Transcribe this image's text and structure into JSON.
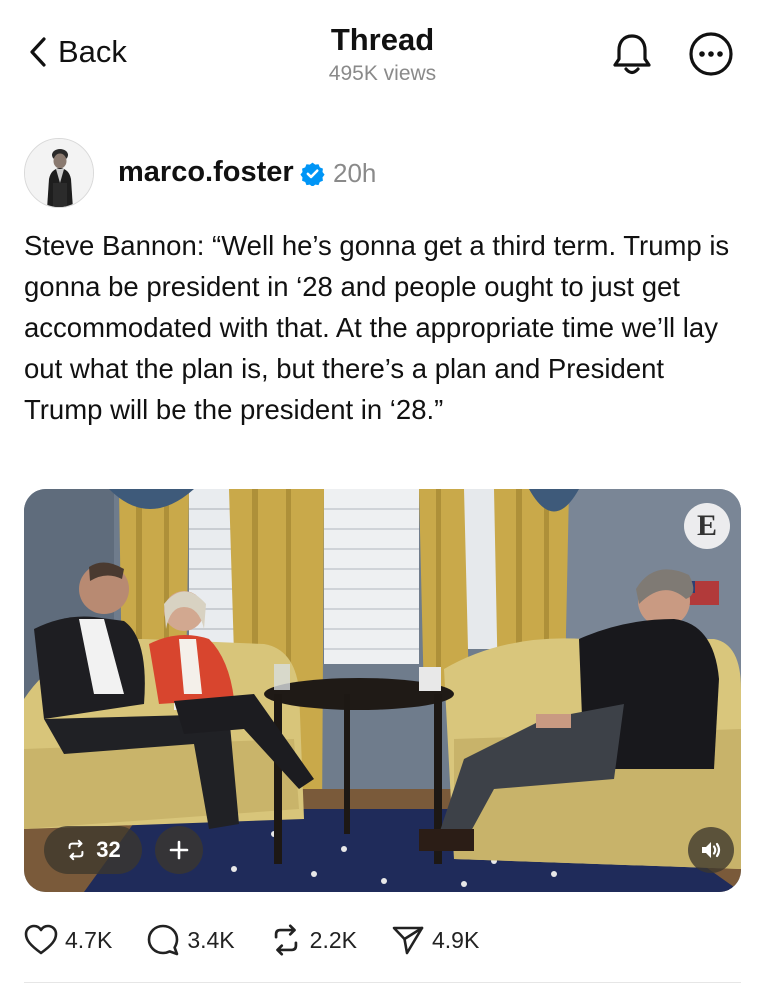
{
  "header": {
    "back_label": "Back",
    "title": "Thread",
    "views": "495K views",
    "icons": [
      "chevron-left-icon",
      "bell-icon",
      "more-icon"
    ]
  },
  "post": {
    "username": "marco.foster",
    "verified": true,
    "timestamp": "20h",
    "text": "Steve Bannon: “Well he’s gonna get a third term. Trump is gonna be president in ‘28 and people ought to just get accommodated with that. At the appropriate time we’ll lay out what the plan is, but there’s a plan and President Trump will be the president in ‘28.”",
    "media": {
      "type": "video",
      "watermark": "E",
      "repost_count": "32",
      "controls": [
        "repost-icon",
        "plus-icon",
        "volume-icon"
      ]
    },
    "actions": {
      "likes": "4.7K",
      "replies": "3.4K",
      "reposts": "2.2K",
      "shares": "4.9K"
    }
  },
  "colors": {
    "verified_blue": "#0095f6",
    "muted_text": "#8a8a8a",
    "text": "#111111"
  }
}
